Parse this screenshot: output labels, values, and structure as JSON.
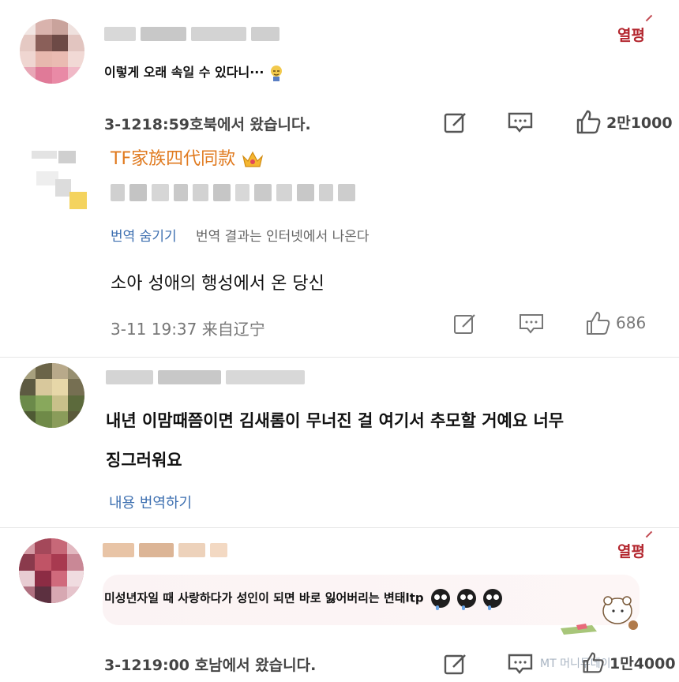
{
  "comments": [
    {
      "badge": "열평",
      "text": "이렇게 오래 속일 수 있다니···",
      "meta": "3-1218:59호북에서 왔습니다.",
      "likes": "2만1000"
    },
    {
      "title": "TF家族四代同款",
      "translate_hide": "번역 숨기기",
      "translate_note": "번역 결과는 인터넷에서 나온다",
      "text": "소아 성애의 행성에서 온 당신",
      "meta": "3-11 19:37 来自辽宁",
      "likes": "686"
    },
    {
      "text_line1": "내년 이맘때쯤이면 김새롬이 무너진 걸 여기서 추모할 거예요 너무",
      "text_line2": "징그러워요",
      "translate_link": "내용 번역하기"
    },
    {
      "badge": "열평",
      "text": "미성년자일 때 사랑하다가 성인이 되면 바로 잃어버리는 변태ltp",
      "meta": "3-1219:00 호남에서 왔습니다.",
      "likes": "1만4000"
    }
  ],
  "watermark": "MT 머니투데이",
  "colors": {
    "accent_red": "#b3262e",
    "link_blue": "#3d6fb0",
    "title_orange": "#e07a1f"
  },
  "icons": [
    "edit-icon",
    "comment-icon",
    "thumbs-up-icon",
    "crown-icon",
    "crying-face-icon"
  ]
}
